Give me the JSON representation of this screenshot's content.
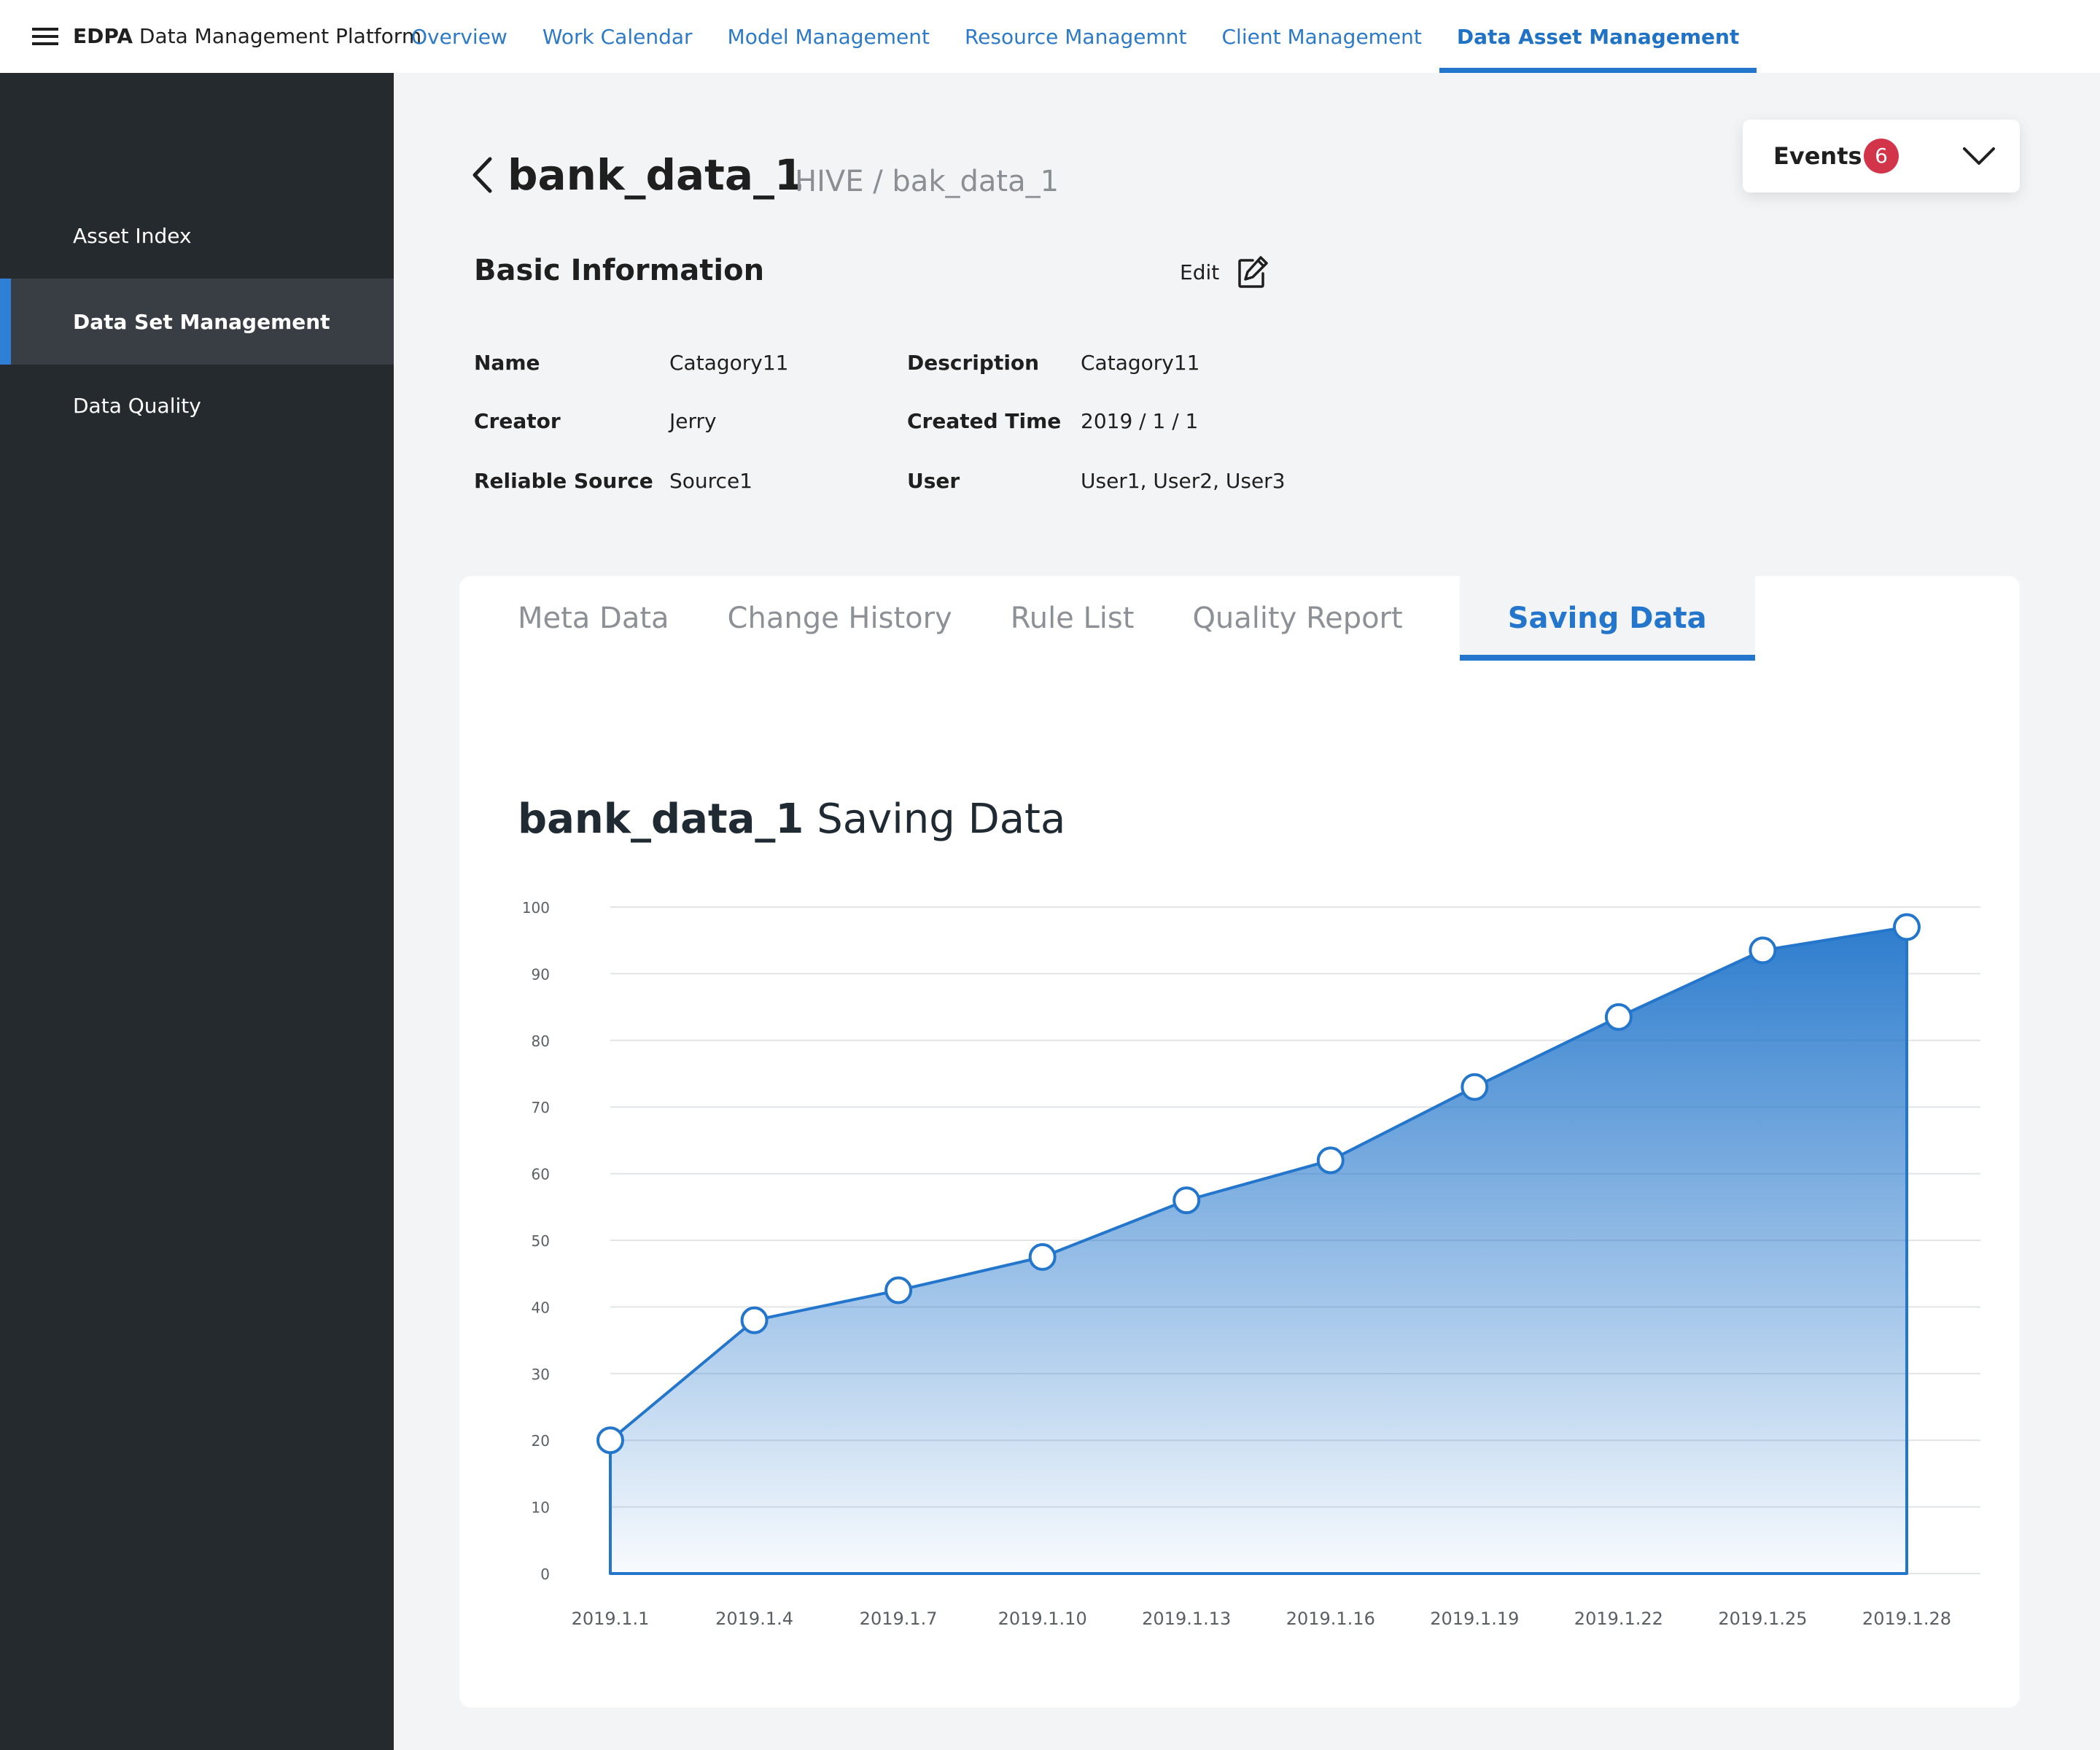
{
  "topbar": {
    "brand_bold": "EDPA",
    "brand_rest": "Data Management Platform",
    "nav": [
      "Overview",
      "Work Calendar",
      "Model Management",
      "Resource Managemnt",
      "Client Management",
      "Data Asset Management"
    ],
    "active_nav": "Data Asset Management"
  },
  "sidebar": {
    "items": [
      {
        "label": "Asset Index"
      },
      {
        "label": "Data Set Management",
        "active": true
      },
      {
        "label": "Data Quality"
      }
    ]
  },
  "header": {
    "title": "bank_data_1",
    "path": "HIVE / bak_data_1"
  },
  "events": {
    "label": "Events",
    "count": "6",
    "badge_color": "#d2344a"
  },
  "basic_info": {
    "title": "Basic Information",
    "edit_label": "Edit",
    "fields": {
      "name": {
        "label": "Name",
        "value": "Catagory11"
      },
      "description": {
        "label": "Description",
        "value": "Catagory11"
      },
      "creator": {
        "label": "Creator",
        "value": "Jerry"
      },
      "created_time": {
        "label": "Created Time",
        "value": "2019 / 1 / 1"
      },
      "reliable_source": {
        "label": "Reliable Source",
        "value": "Source1"
      },
      "user": {
        "label": "User",
        "value": "User1, User2, User3"
      }
    }
  },
  "tabs": {
    "items": [
      "Meta Data",
      "Change History",
      "Rule List",
      "Quality Report",
      "Saving Data"
    ],
    "active": "Saving Data"
  },
  "chart_heading": {
    "bold": "bank_data_1",
    "rest": "Saving Data"
  },
  "accent_color": "#2376cb",
  "chart_data": {
    "type": "area",
    "title": "bank_data_1 Saving Data",
    "xlabel": "",
    "ylabel": "",
    "x": [
      "2019.1.1",
      "2019.1.4",
      "2019.1.7",
      "2019.1.10",
      "2019.1.13",
      "2019.1.16",
      "2019.1.19",
      "2019.1.22",
      "2019.1.25",
      "2019.1.28"
    ],
    "values": [
      20,
      38,
      42.5,
      47.5,
      56,
      62,
      73,
      83.5,
      93.5,
      97
    ],
    "y_ticks": [
      0,
      10,
      20,
      30,
      40,
      50,
      60,
      70,
      80,
      90,
      100
    ],
    "ylim": [
      0,
      100
    ],
    "grid": true,
    "legend": "none",
    "color": "#2376cb"
  }
}
